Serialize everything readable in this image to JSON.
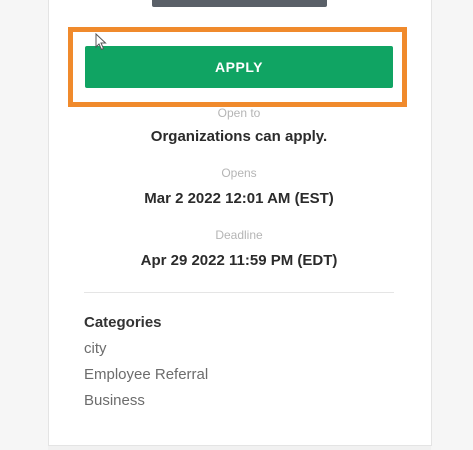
{
  "apply_button": {
    "label": "APPLY"
  },
  "details": {
    "open_to": {
      "label": "Open to",
      "value": "Organizations can apply."
    },
    "opens": {
      "label": "Opens",
      "value": "Mar 2 2022 12:01 AM (EST)"
    },
    "deadline": {
      "label": "Deadline",
      "value": "Apr 29 2022 11:59 PM (EDT)"
    }
  },
  "categories": {
    "heading": "Categories",
    "items": [
      "city",
      "Employee Referral",
      "Business"
    ]
  },
  "colors": {
    "apply_button": "#10a463",
    "highlight_box": "#f08a2c"
  },
  "icons": {
    "cursor": "mouse-pointer-icon"
  }
}
